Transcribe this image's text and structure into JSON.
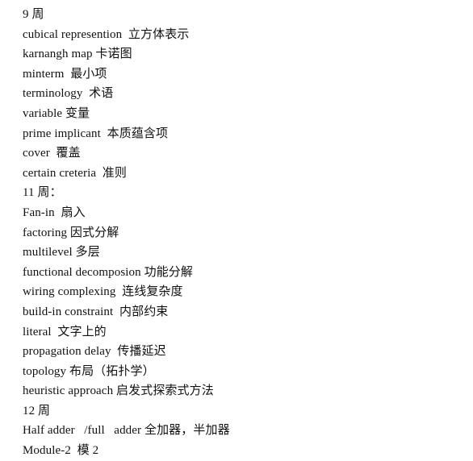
{
  "document": {
    "type": "glossary-notes",
    "background_color": "#ffffff",
    "text_color": "#111111",
    "lines": [
      {
        "text": "9 周",
        "kind": "section-heading"
      },
      {
        "text": "cubical represention  立方体表示",
        "kind": "entry"
      },
      {
        "text": "karnangh map 卡诺图",
        "kind": "entry"
      },
      {
        "text": "minterm  最小项",
        "kind": "entry"
      },
      {
        "text": "terminology  术语",
        "kind": "entry"
      },
      {
        "text": "variable 变量",
        "kind": "entry"
      },
      {
        "text": "prime implicant  本质蕴含项",
        "kind": "entry"
      },
      {
        "text": "cover  覆盖",
        "kind": "entry"
      },
      {
        "text": "certain creteria  准则",
        "kind": "entry"
      },
      {
        "text": "11 周：",
        "kind": "section-heading"
      },
      {
        "text": "Fan-in  扇入",
        "kind": "entry"
      },
      {
        "text": "factoring 因式分解",
        "kind": "entry"
      },
      {
        "text": "multilevel 多层",
        "kind": "entry"
      },
      {
        "text": "functional decomposion 功能分解",
        "kind": "entry"
      },
      {
        "text": "wiring complexing  连线复杂度",
        "kind": "entry"
      },
      {
        "text": "build-in constraint  内部约束",
        "kind": "entry"
      },
      {
        "text": "literal  文字上的",
        "kind": "entry"
      },
      {
        "text": "propagation delay  传播延迟",
        "kind": "entry"
      },
      {
        "text": "topology 布局（拓扑学）",
        "kind": "entry"
      },
      {
        "text": "heuristic approach 启发式探索式方法",
        "kind": "entry"
      },
      {
        "text": "12 周",
        "kind": "section-heading"
      },
      {
        "text": "Half adder   /full   adder 全加器，半加器",
        "kind": "entry"
      },
      {
        "text": "Module-2  模 2",
        "kind": "entry"
      }
    ]
  }
}
